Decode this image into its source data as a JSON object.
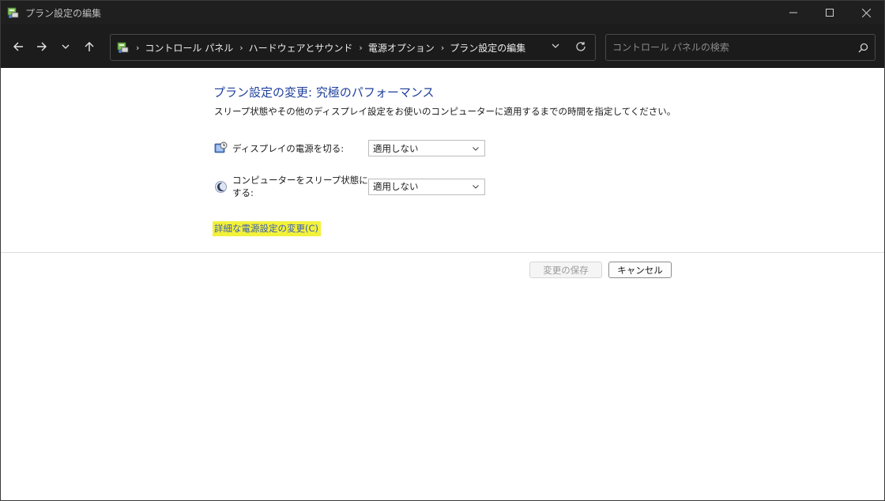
{
  "window": {
    "title": "プラン設定の編集",
    "controls": [
      "minimize-icon",
      "maximize-icon",
      "close-icon"
    ]
  },
  "navigation": {
    "breadcrumbs": [
      "コントロール パネル",
      "ハードウェアとサウンド",
      "電源オプション",
      "プラン設定の編集"
    ],
    "search_placeholder": "コントロール パネルの検索"
  },
  "main": {
    "heading": "プラン設定の変更: 究極のパフォーマンス",
    "description": "スリープ状態やその他のディスプレイ設定をお使いのコンピューターに適用するまでの時間を指定してください。",
    "settings": [
      {
        "label": "ディスプレイの電源を切る:",
        "value": "適用しない",
        "icon": "display-power-icon"
      },
      {
        "label": "コンピューターをスリープ状態にする:",
        "value": "適用しない",
        "icon": "sleep-moon-icon"
      }
    ],
    "advanced_link": "詳細な電源設定の変更(C)",
    "save_button": "変更の保存",
    "cancel_button": "キャンセル"
  },
  "colors": {
    "heading": "#1e3f9a",
    "link": "#3b5bb5",
    "highlight": "#f3f23a",
    "titlebar": "#1f1f1f"
  }
}
